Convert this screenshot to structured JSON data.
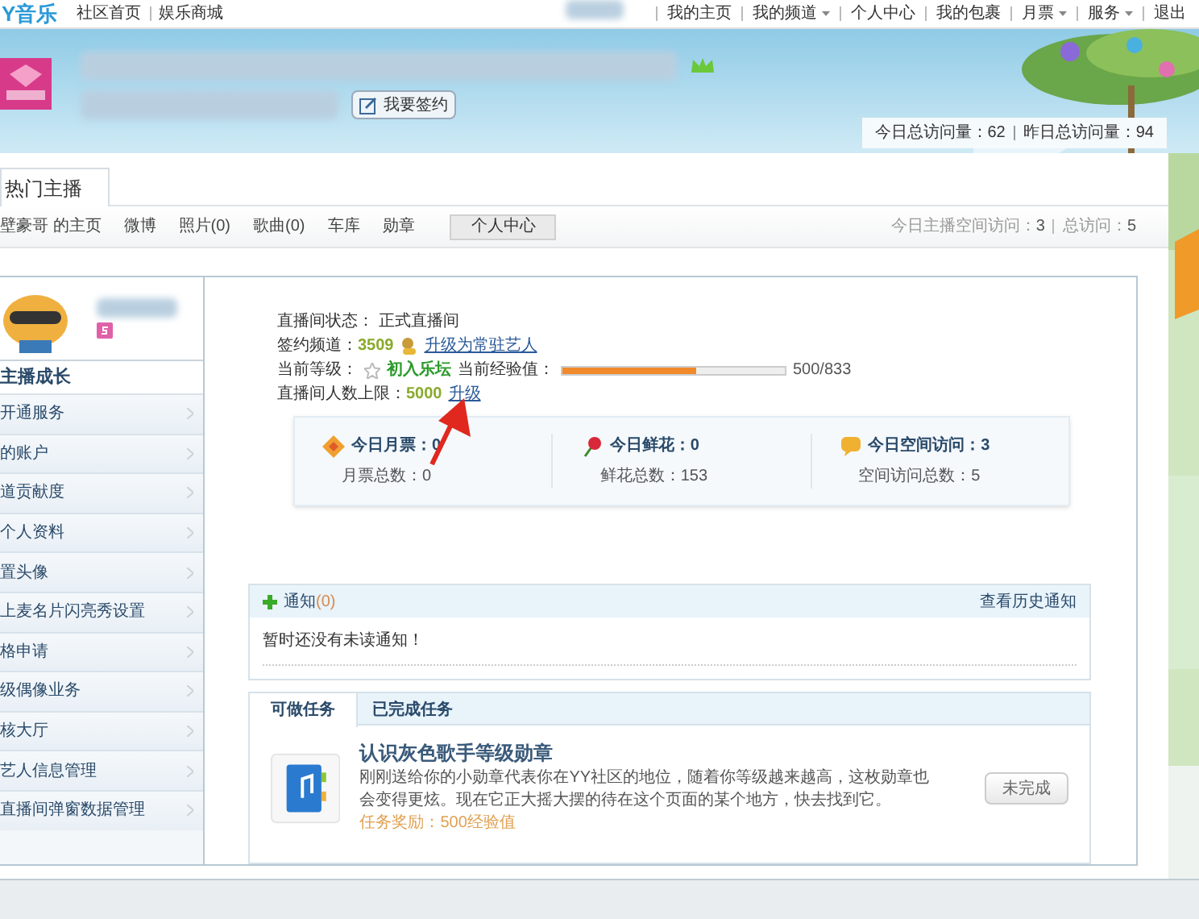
{
  "top_bar": {
    "logo": "Y音乐",
    "links": [
      "社区首页",
      "娱乐商城"
    ],
    "user_links": [
      {
        "label": "我的主页",
        "dropdown": false
      },
      {
        "label": "我的频道",
        "dropdown": true
      },
      {
        "label": "个人中心",
        "dropdown": false
      },
      {
        "label": "我的包裹",
        "dropdown": false
      },
      {
        "label": "月票",
        "dropdown": true
      },
      {
        "label": "服务",
        "dropdown": true
      },
      {
        "label": "退出",
        "dropdown": false
      }
    ]
  },
  "banner": {
    "sign_button": "我要签约",
    "visits": [
      {
        "label": "今日总访问量：",
        "value": "62"
      },
      {
        "label": "昨日总访问量：",
        "value": "94"
      }
    ]
  },
  "page_tabs": [
    {
      "label": "热门主播",
      "selected": true
    }
  ],
  "nav": {
    "items": [
      {
        "label": "壁豪哥 的主页",
        "selected": false
      },
      {
        "label": "微博",
        "selected": false
      },
      {
        "label": "照片(0)",
        "selected": false
      },
      {
        "label": "歌曲(0)",
        "selected": false
      },
      {
        "label": "车库",
        "selected": false
      },
      {
        "label": "勋章",
        "selected": false
      },
      {
        "label": "个人中心",
        "selected": true
      }
    ],
    "stats": [
      {
        "label": "今日主播空间访问：",
        "value": "3"
      },
      {
        "label": "总访问：",
        "value": "5"
      }
    ]
  },
  "sidebar": {
    "title": "主播成长",
    "items": [
      "开通服务",
      "的账户",
      "道贡献度",
      "个人资料",
      "置头像",
      "上麦名片闪亮秀设置",
      "格申请",
      "级偶像业务",
      "核大厅",
      "艺人信息管理",
      "直播间弹窗数据管理"
    ]
  },
  "profile": {
    "status_label": "直播间状态：",
    "status": "正式直播间",
    "channel_label": "签约频道：",
    "channel": "3509",
    "channel_link": "升级为常驻艺人",
    "level_label": "当前等级：",
    "level_name": "初入乐坛",
    "exp_label": "当前经验值：",
    "exp": {
      "level": 0.6,
      "reading": "500/833"
    },
    "limit_label": "直播间人数上限：",
    "limit": "5000",
    "limit_link": "升级"
  },
  "stats": [
    {
      "kind": "ticket",
      "title": "今日月票：",
      "value": "0",
      "total_label": "月票总数：",
      "total": "0"
    },
    {
      "kind": "flower",
      "title": "今日鲜花：",
      "value": "0",
      "total_label": "鲜花总数：",
      "total": "153"
    },
    {
      "kind": "visit",
      "title": "今日空间访问：",
      "value": "3",
      "total_label": "空间访问总数：",
      "total": "5"
    }
  ],
  "notices": {
    "title": "通知",
    "count": "(0)",
    "history_link": "查看历史通知",
    "empty": "暂时还没有未读通知！"
  },
  "tasks": {
    "tabs": [
      {
        "label": "可做任务",
        "selected": true
      },
      {
        "label": "已完成任务",
        "selected": false
      }
    ],
    "items": [
      {
        "title": "认识灰色歌手等级勋章",
        "description": "刚刚送给你的小勋章代表你在YY社区的地位，随着你等级越来越高，这枚勋章也会变得更炫。现在它正大摇大摆的待在这个页面的某个地方，快去找到它。",
        "reward": "任务奖励：500经验值",
        "button": "未完成",
        "done": false
      }
    ]
  }
}
